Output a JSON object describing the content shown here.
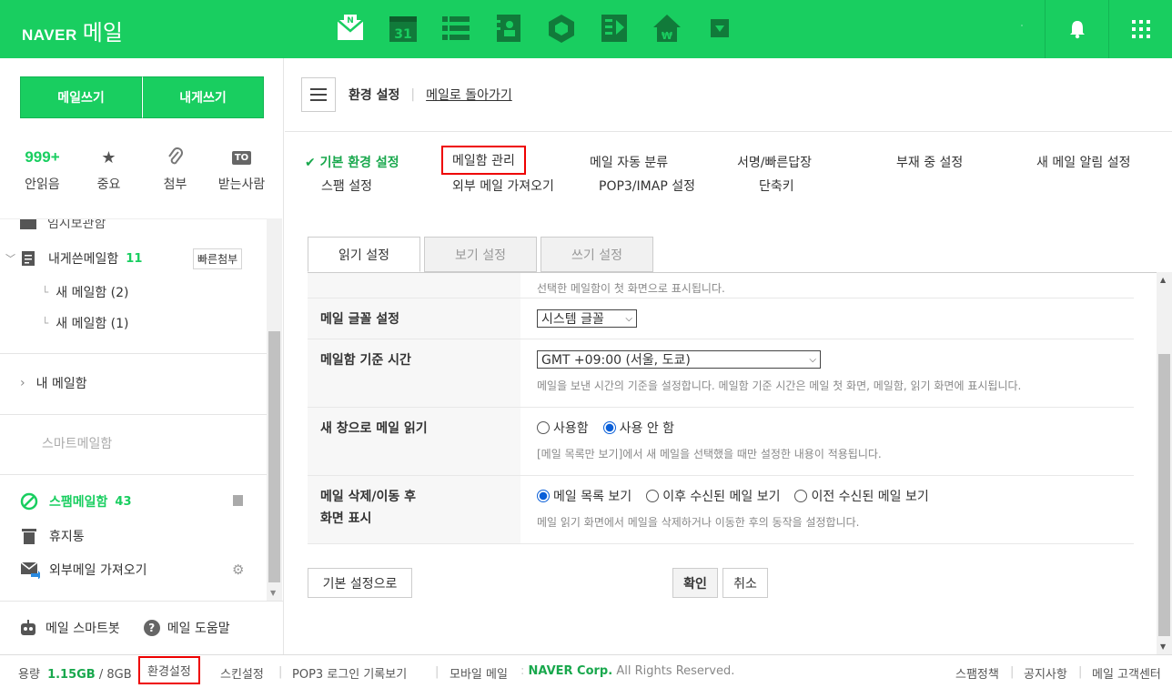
{
  "brand": {
    "naver": "NAVER",
    "mail": "메일"
  },
  "colors": {
    "accent": "#19ce60",
    "highlight_border": "#ee0000"
  },
  "topbar": {
    "apps": [
      "mail-icon",
      "calendar-icon",
      "list-icon",
      "contacts-icon",
      "box-icon",
      "memo-icon",
      "pay-icon",
      "more-icon"
    ],
    "calendar_day": "31",
    "dot": "˙"
  },
  "sidebar": {
    "compose": "메일쓰기",
    "self_compose": "내게쓰기",
    "quick": [
      {
        "top": "999+",
        "label": "안읽음"
      },
      {
        "label": "중요"
      },
      {
        "label": "첨부"
      },
      {
        "top": "TO",
        "label": "받는사람"
      }
    ],
    "folders": {
      "drafts": "임시보관함",
      "to_self": "내게쓴메일함",
      "to_self_count": "11",
      "quick_attach": "빠른첨부",
      "sub1": "새 메일함 (2)",
      "sub2": "새 메일함 (1)",
      "my_mailbox": "내 메일함",
      "smart": "스마트메일함",
      "spam": "스팸메일함",
      "spam_count": "43",
      "trash": "휴지통",
      "external": "외부메일 가져오기"
    },
    "bottom": {
      "smartbot": "메일 스마트봇",
      "help": "메일 도움말"
    }
  },
  "breadcrumb": {
    "title": "환경 설정",
    "back": "메일로 돌아가기"
  },
  "settings_nav": {
    "basic": "기본 환경 설정",
    "mailbox": "메일함 관리",
    "auto_sort": "메일 자동 분류",
    "signature": "서명/빠른답장",
    "absence": "부재 중 설정",
    "notify": "새 메일 알림 설정",
    "spam": "스팸 설정",
    "external": "외부 메일 가져오기",
    "pop3": "POP3/IMAP 설정",
    "shortcut": "단축키"
  },
  "tabs": [
    {
      "label": "읽기 설정",
      "active": true
    },
    {
      "label": "보기 설정",
      "active": false
    },
    {
      "label": "쓰기 설정",
      "active": false
    }
  ],
  "rows": {
    "cut_hint": "선택한 메일함이 첫 화면으로 표시됩니다.",
    "font": {
      "label": "메일 글꼴 설정",
      "value": "시스템 글꼴"
    },
    "timezone": {
      "label": "메일함 기준 시간",
      "value": "GMT +09:00 (서울, 도쿄)",
      "hint": "메일을 보낸 시간의 기준을 설정합니다. 메일함 기준 시간은 메일 첫 화면, 메일함, 읽기 화면에 표시됩니다."
    },
    "new_window": {
      "label": "새 창으로 메일 읽기",
      "opt1": "사용함",
      "opt2": "사용 안 함",
      "selected": "사용 안 함",
      "hint": "[메일 목록만 보기]에서 새 메일을 선택했을 때만 설정한 내용이 적용됩니다."
    },
    "after_delete": {
      "label1": "메일 삭제/이동 후",
      "label2": "화면 표시",
      "opt1": "메일 목록 보기",
      "opt2": "이후 수신된 메일 보기",
      "opt3": "이전 수신된 메일 보기",
      "selected": "메일 목록 보기",
      "hint": "메일 읽기 화면에서 메일을 삭제하거나 이동한 후의 동작을 설정합니다."
    }
  },
  "buttons": {
    "reset": "기본 설정으로",
    "ok": "확인",
    "cancel": "취소"
  },
  "footer": {
    "capacity_label": "용량",
    "used": "1.15GB",
    "total": "/ 8GB",
    "settings": "환경설정",
    "skin": "스킨설정",
    "pop3log": "POP3 로그인 기록보기",
    "mobile": "모바일 메일",
    "corp": "NAVER Corp.",
    "rights": "All Rights Reserved.",
    "spam_policy": "스팸정책",
    "notice": "공지사항",
    "support": "메일 고객센터"
  }
}
